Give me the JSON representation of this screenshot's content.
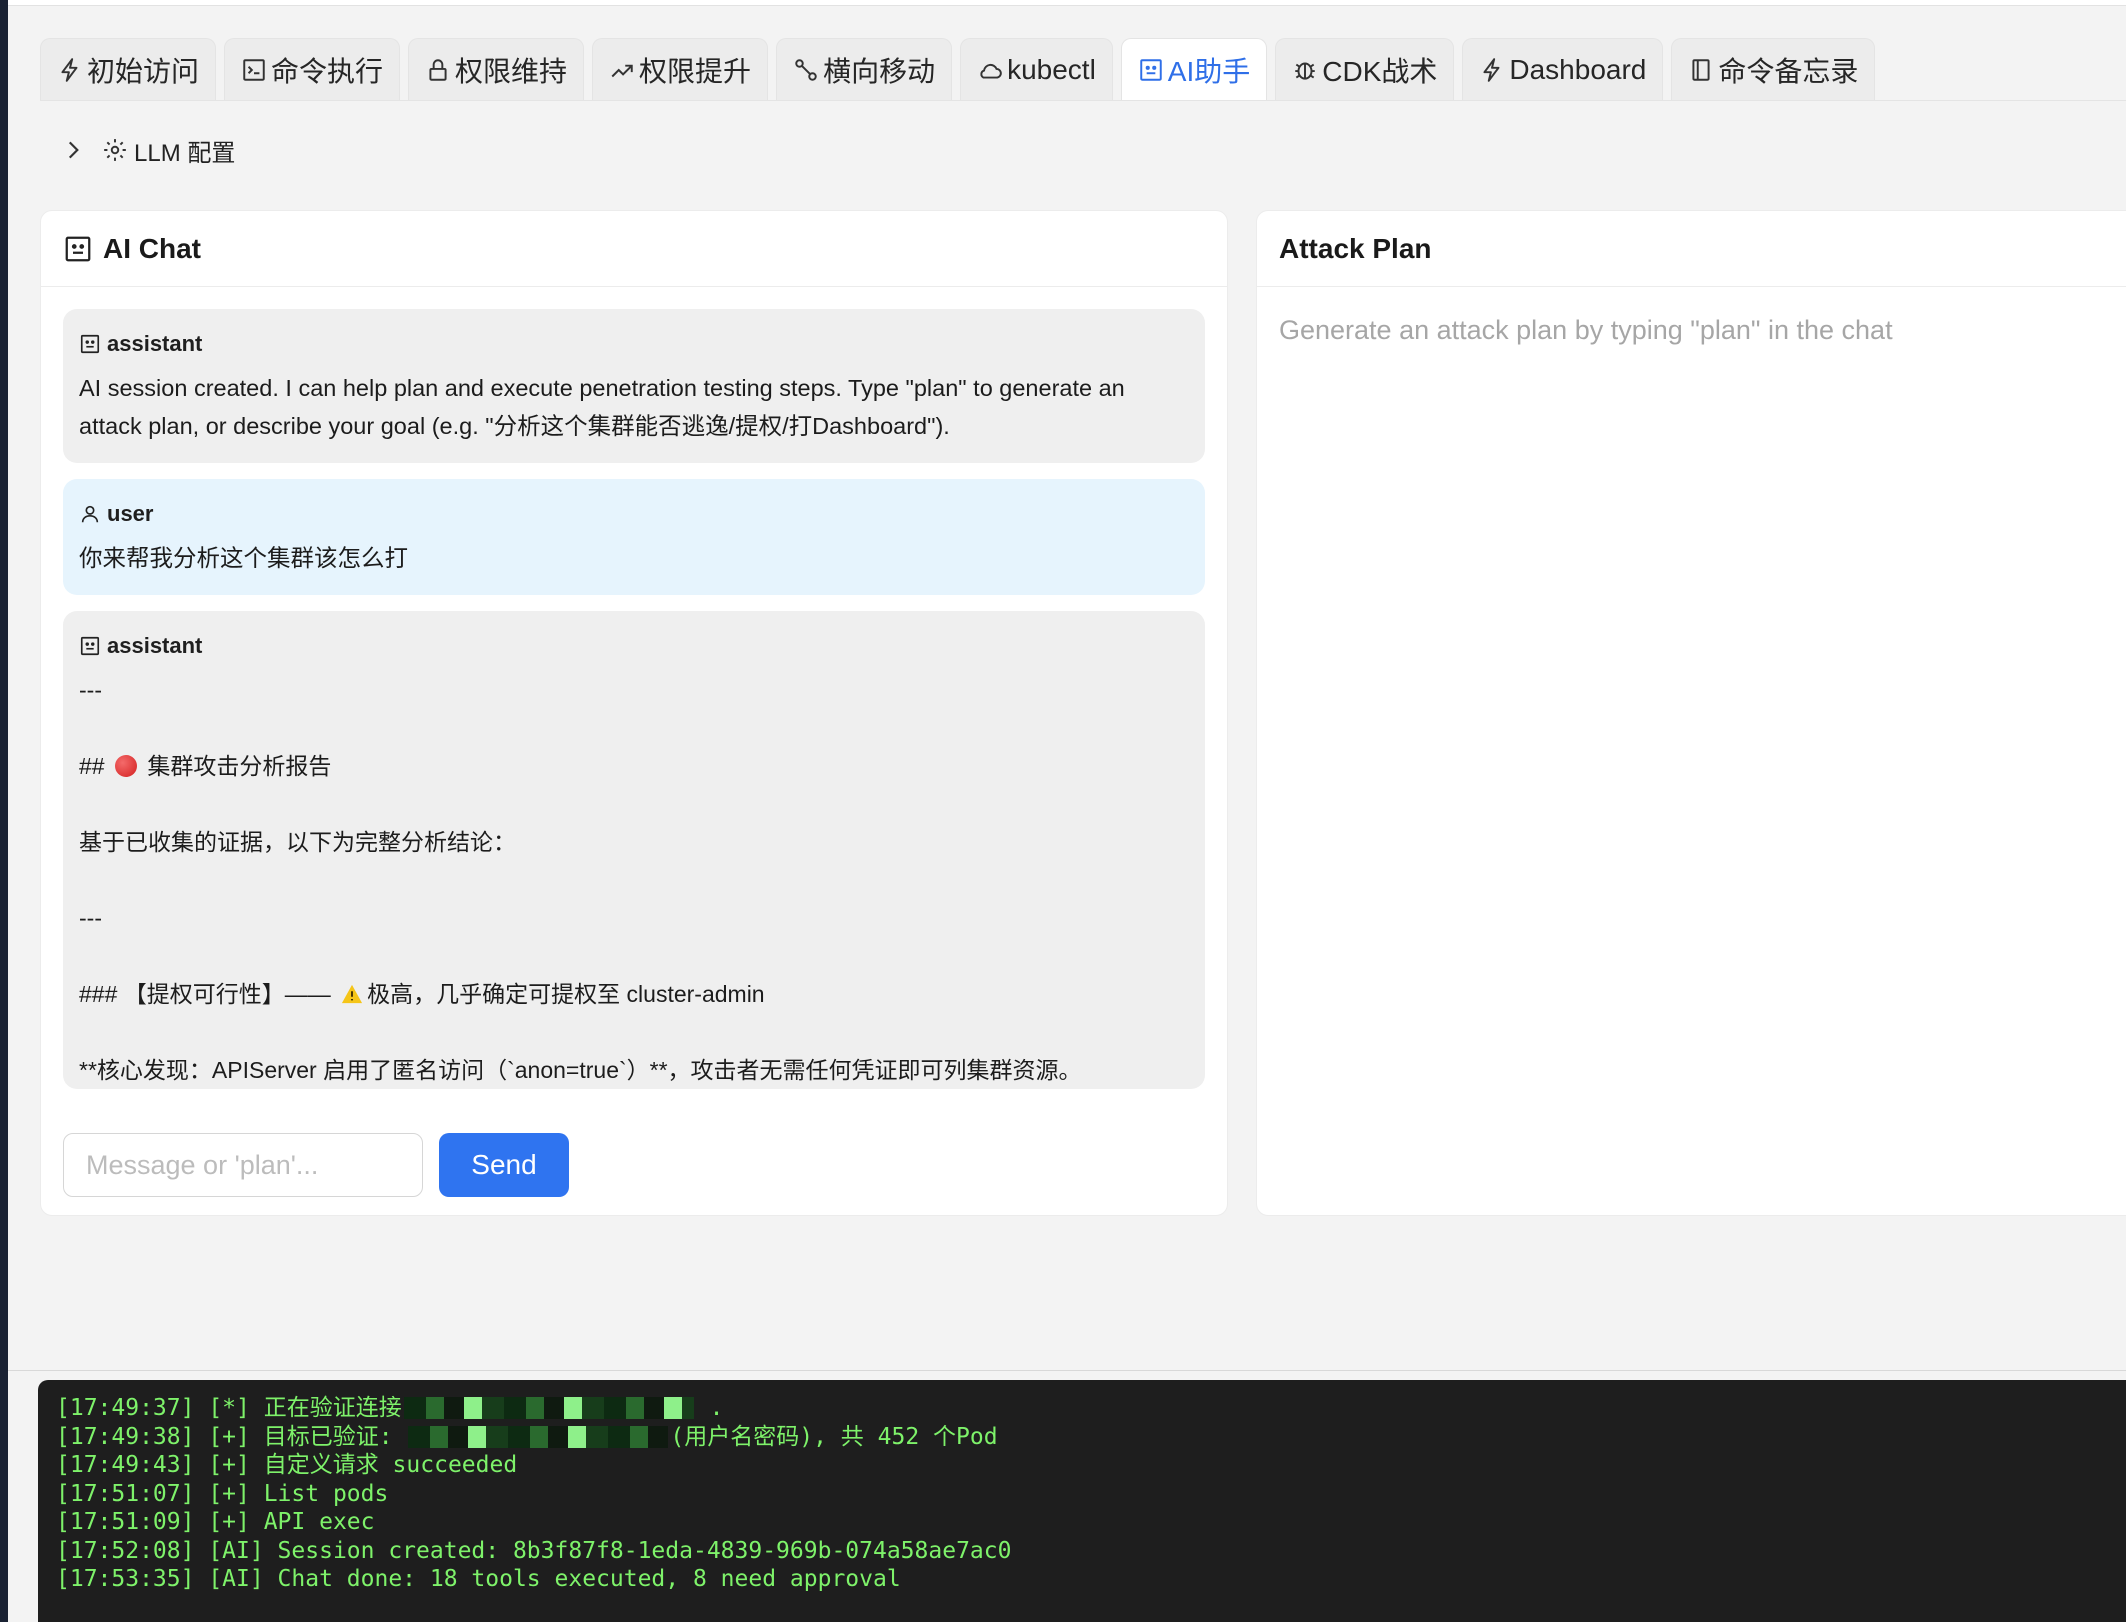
{
  "tabs": [
    {
      "label": "初始访问",
      "icon": "bolt-icon"
    },
    {
      "label": "命令执行",
      "icon": "terminal-icon"
    },
    {
      "label": "权限维持",
      "icon": "lock-icon"
    },
    {
      "label": "权限提升",
      "icon": "trend-up-icon"
    },
    {
      "label": "横向移动",
      "icon": "nodes-icon"
    },
    {
      "label": "kubectl",
      "icon": "cloud-icon"
    },
    {
      "label": "AI助手",
      "icon": "robot-icon",
      "active": true
    },
    {
      "label": "CDK战术",
      "icon": "bug-icon"
    },
    {
      "label": "Dashboard",
      "icon": "bolt-icon"
    },
    {
      "label": "命令备忘录",
      "icon": "book-icon"
    }
  ],
  "llm_config": {
    "label": "LLM 配置"
  },
  "chat": {
    "title": "AI Chat",
    "messages": [
      {
        "role": "assistant",
        "text": "AI session created. I can help plan and execute penetration testing steps. Type \"plan\" to generate an attack plan, or describe your goal (e.g. \"分析这个集群能否逃逸/提权/打Dashboard\")."
      },
      {
        "role": "user",
        "text": "你来帮我分析这个集群该怎么打"
      },
      {
        "role": "assistant",
        "lines": [
          "---",
          "",
          "## ",
          "集群攻击分析报告",
          "",
          "基于已收集的证据，以下为完整分析结论：",
          "",
          "---",
          "",
          "### 【提权可行性】—— ",
          "极高，几乎确定可提权至 cluster-admin",
          "",
          "**核心发现：APIServer 启用了匿名访问（`anon=true`）**，攻击者无需任何凭证即可列集群资源。"
        ]
      }
    ],
    "input_placeholder": "Message or 'plan'...",
    "input_value": "",
    "send_label": "Send"
  },
  "plan": {
    "title": "Attack Plan",
    "empty_text": "Generate an attack plan by typing \"plan\" in the chat"
  },
  "console": {
    "lines": [
      {
        "pre": "[17:49:37] [*] 正在验证连接",
        "post": " ."
      },
      {
        "pre": "[17:49:38] [+] 目标已验证: ",
        "post": "(用户名密码), 共 452 个Pod"
      },
      {
        "pre": "[17:49:43] [+] 自定义请求 succeeded",
        "post": ""
      },
      {
        "pre": "[17:51:07] [+] List pods",
        "post": ""
      },
      {
        "pre": "[17:51:09] [+] API exec",
        "post": ""
      },
      {
        "pre": "[17:52:08] [AI] Session created: 8b3f87f8-1eda-4839-969b-074a58ae7ac0",
        "post": ""
      },
      {
        "pre": "[17:53:35] [AI] Chat done: 18 tools executed, 8 need approval",
        "post": ""
      }
    ],
    "text_color": "#7ef26a",
    "background": "#1e1e1e"
  },
  "colors": {
    "accent": "#2f74f0",
    "active_tab": "#2f6fe8",
    "user_bubble": "#e6f4fd",
    "assistant_bubble": "#efefef"
  }
}
